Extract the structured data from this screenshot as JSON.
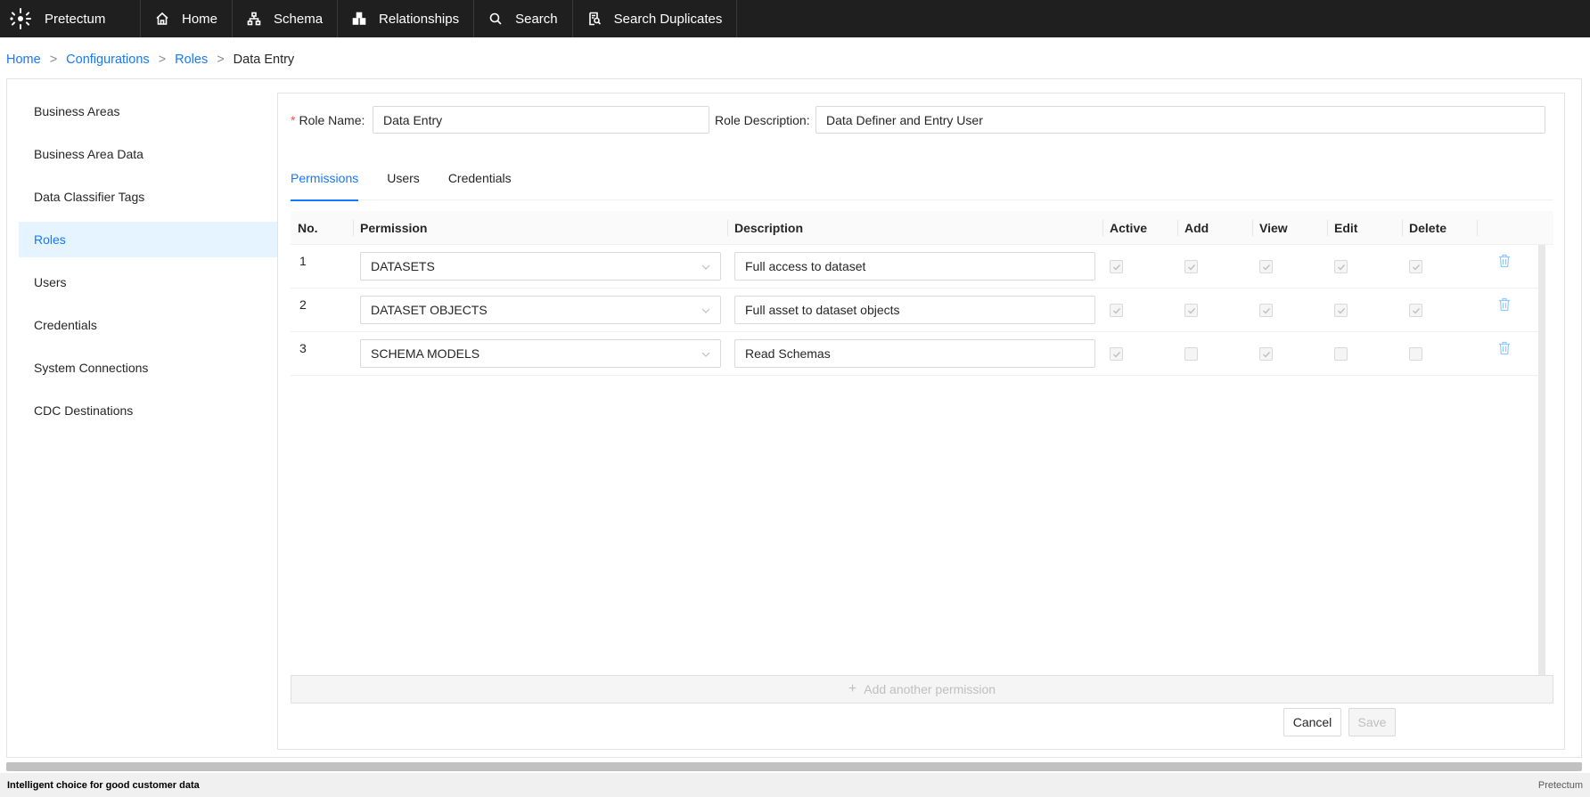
{
  "app": {
    "brand": "Pretectum"
  },
  "nav": [
    {
      "label": "Home",
      "icon": "home-icon"
    },
    {
      "label": "Schema",
      "icon": "schema-icon"
    },
    {
      "label": "Relationships",
      "icon": "relationships-icon"
    },
    {
      "label": "Search",
      "icon": "search-icon"
    },
    {
      "label": "Search Duplicates",
      "icon": "search-duplicates-icon"
    }
  ],
  "breadcrumb": {
    "items": [
      "Home",
      "Configurations",
      "Roles"
    ],
    "current": "Data Entry",
    "separator": ">"
  },
  "sidebar": {
    "items": [
      {
        "label": "Business Areas"
      },
      {
        "label": "Business Area Data"
      },
      {
        "label": "Data Classifier Tags"
      },
      {
        "label": "Roles",
        "active": true
      },
      {
        "label": "Users"
      },
      {
        "label": "Credentials"
      },
      {
        "label": "System Connections"
      },
      {
        "label": "CDC Destinations"
      }
    ]
  },
  "form": {
    "role_name_label": "Role Name",
    "role_name_value": "Data Entry",
    "role_desc_label": "Role Description",
    "role_desc_value": "Data Definer and Entry User"
  },
  "tabs": [
    {
      "label": "Permissions",
      "active": true
    },
    {
      "label": "Users"
    },
    {
      "label": "Credentials"
    }
  ],
  "table": {
    "headers": [
      "No.",
      "Permission",
      "Description",
      "Active",
      "Add",
      "View",
      "Edit",
      "Delete"
    ],
    "rows": [
      {
        "no": "1",
        "permission": "DATASETS",
        "description": "Full access to dataset",
        "active": true,
        "add": true,
        "view": true,
        "edit": true,
        "delete": true
      },
      {
        "no": "2",
        "permission": "DATASET OBJECTS",
        "description": "Full asset to dataset objects",
        "active": true,
        "add": true,
        "view": true,
        "edit": true,
        "delete": true
      },
      {
        "no": "3",
        "permission": "SCHEMA MODELS",
        "description": "Read Schemas",
        "active": true,
        "add": false,
        "view": true,
        "edit": false,
        "delete": false
      }
    ]
  },
  "actions": {
    "add_permission": "Add another permission",
    "cancel": "Cancel",
    "save": "Save"
  },
  "footer": {
    "left": "Intelligent choice for good customer data",
    "right": "Pretectum"
  },
  "colors": {
    "accent": "#1677ff",
    "topbar": "#1f1f1f",
    "required": "#ff4d4f"
  }
}
